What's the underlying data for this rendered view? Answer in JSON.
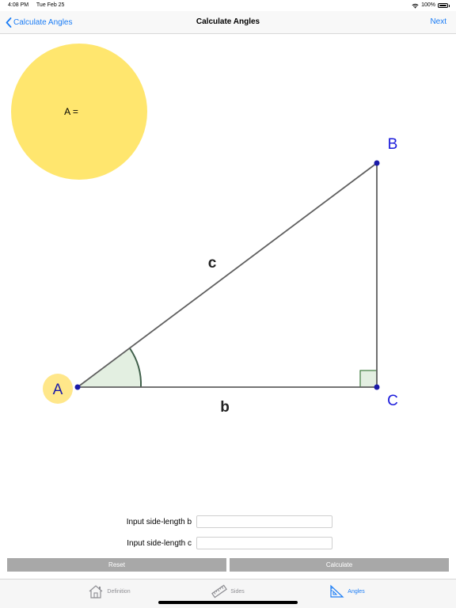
{
  "status_bar": {
    "time": "4:08 PM",
    "date": "Tue Feb 25",
    "battery": "100%"
  },
  "nav": {
    "back_label": "Calculate Angles",
    "title": "Calculate Angles",
    "next_label": "Next"
  },
  "result": {
    "text": "A ="
  },
  "diagram": {
    "vertex_a": "A",
    "vertex_b": "B",
    "vertex_c": "C",
    "side_b": "b",
    "side_c": "c"
  },
  "inputs": [
    {
      "label": "Input side-length b",
      "value": ""
    },
    {
      "label": "Input side-length c",
      "value": ""
    }
  ],
  "buttons": {
    "reset": "Reset",
    "calculate": "Calculate"
  },
  "tabs": [
    {
      "label": "Definition",
      "icon": "house-icon",
      "active": false
    },
    {
      "label": "Sides",
      "icon": "ruler-icon",
      "active": false
    },
    {
      "label": "Angles",
      "icon": "set-square-icon",
      "active": true
    }
  ],
  "colors": {
    "accent": "#1a7cf5",
    "result_fill": "#ffe66e",
    "vertex_label": "#1a1adb",
    "angle_fill": "#e3efe1",
    "button_fill": "#a8a8a8"
  }
}
